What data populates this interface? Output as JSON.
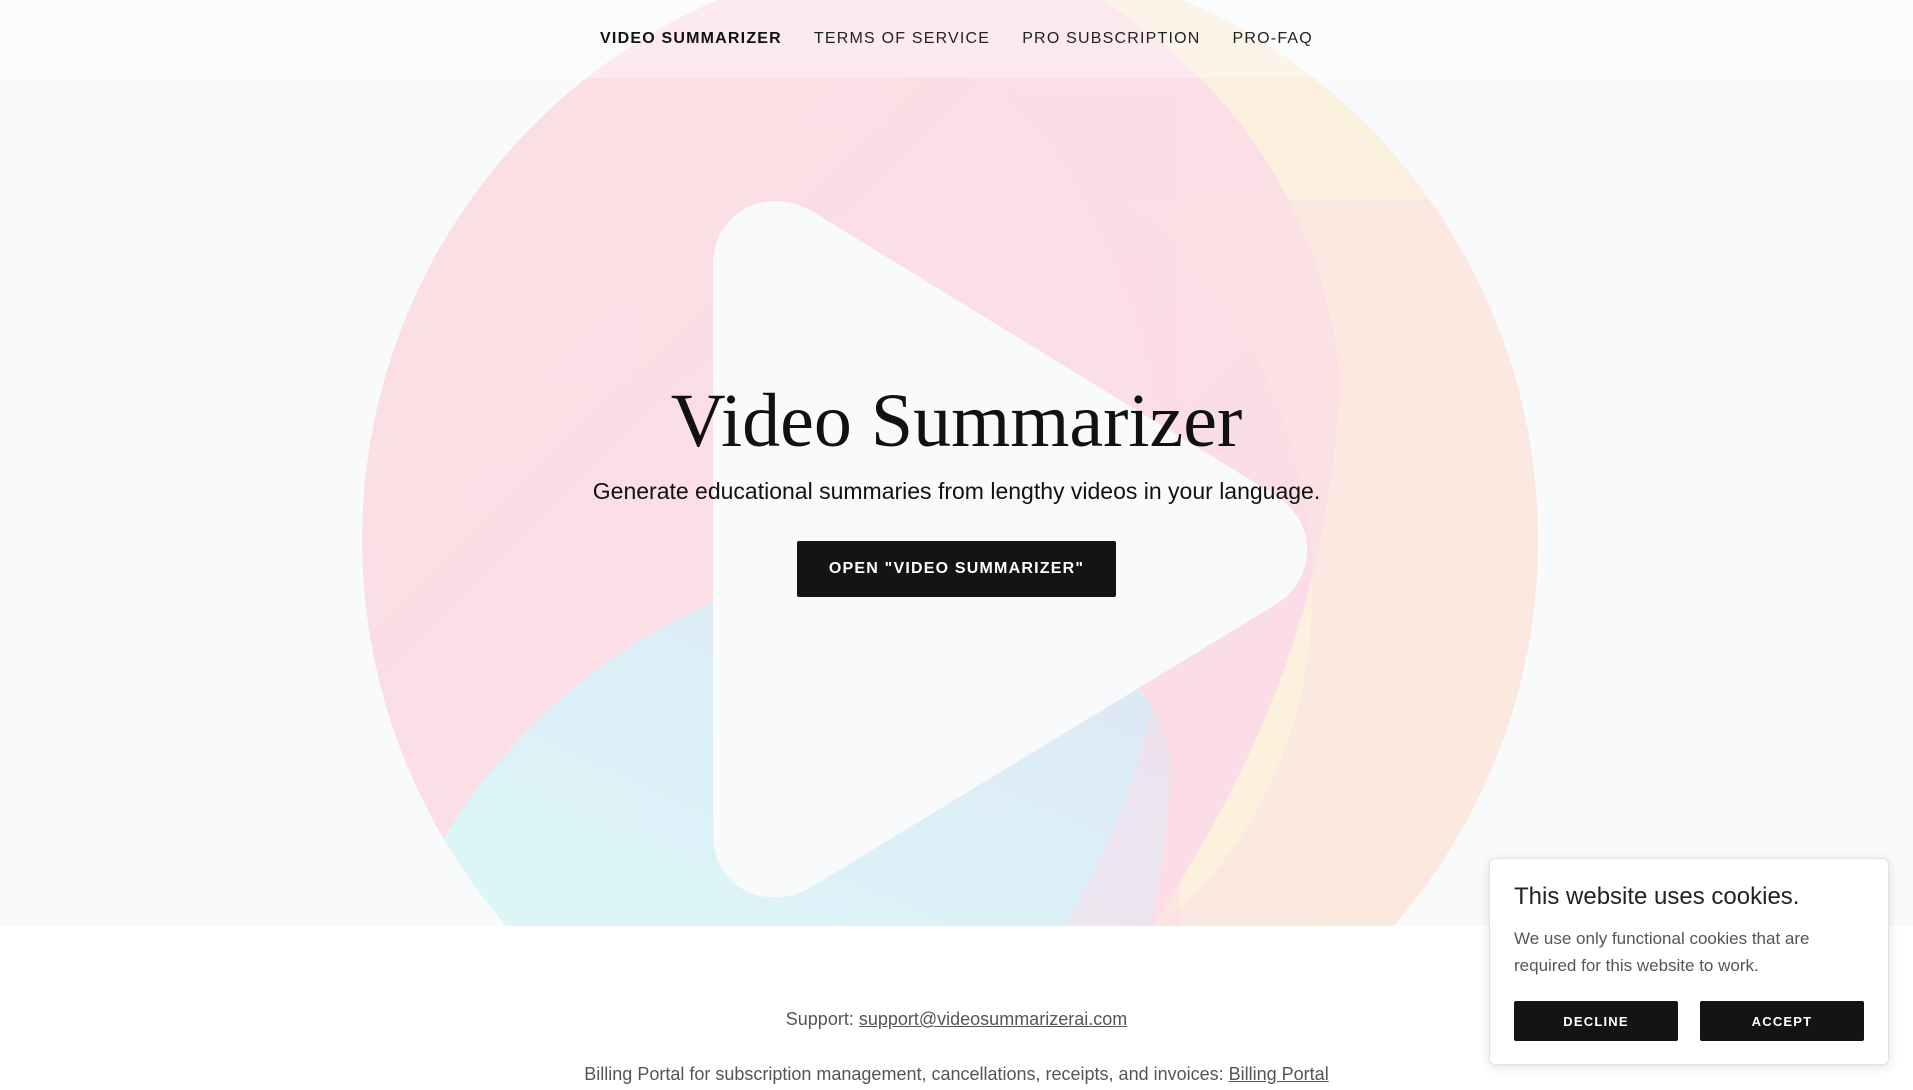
{
  "nav": {
    "items": [
      {
        "label": "VIDEO SUMMARIZER",
        "active": true
      },
      {
        "label": "TERMS OF SERVICE",
        "active": false
      },
      {
        "label": "PRO SUBSCRIPTION",
        "active": false
      },
      {
        "label": "PRO-FAQ",
        "active": false
      }
    ]
  },
  "hero": {
    "title": "Video Summarizer",
    "subtitle": "Generate educational summaries from lengthy videos in your language.",
    "cta_label": "OPEN \"VIDEO SUMMARIZER\"",
    "background_icon": "play-icon",
    "colors": {
      "pink": "#fbdbe8",
      "yellow": "#fbf3dc",
      "blue": "#dbeaf8",
      "cyan": "#dcf7f8",
      "background": "#f8fafc"
    }
  },
  "footer": {
    "support_label": "Support:",
    "support_email": "support@videosummarizerai.com",
    "billing_text": "Billing Portal for subscription management, cancellations, receipts, and invoices:",
    "billing_link": "Billing Portal"
  },
  "cookie_banner": {
    "title": "This website uses cookies.",
    "text": "We use only functional cookies that are required for this website to work.",
    "decline_label": "DECLINE",
    "accept_label": "ACCEPT"
  }
}
